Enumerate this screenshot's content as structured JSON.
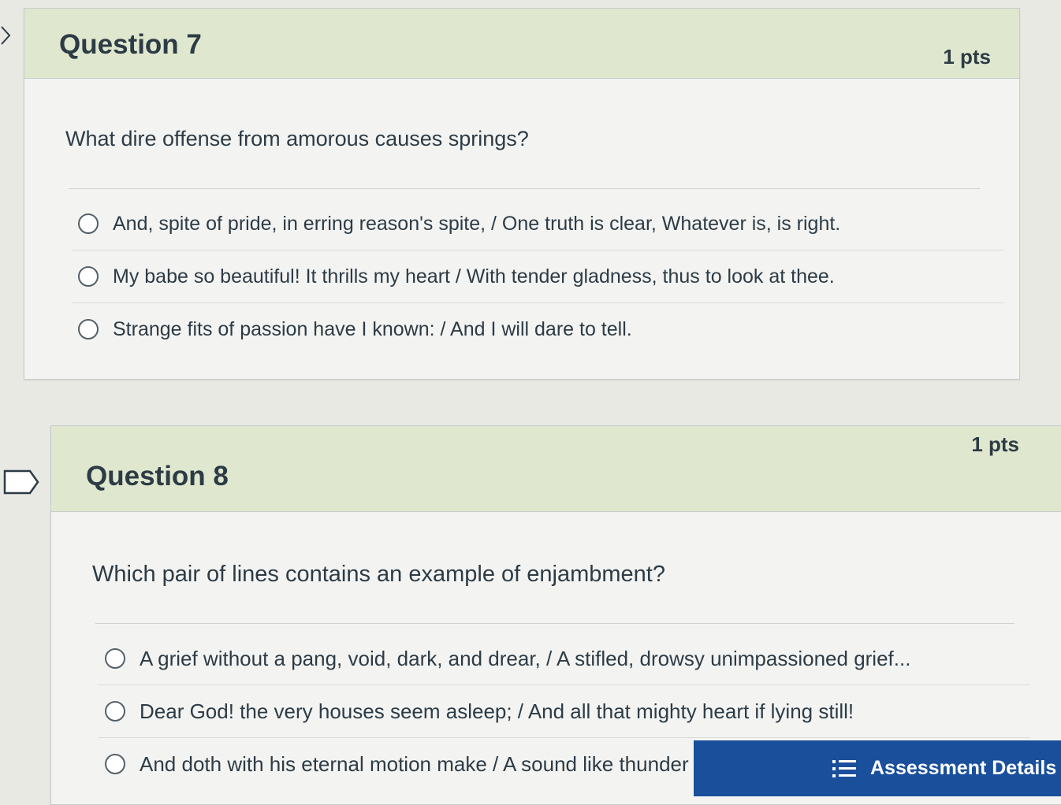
{
  "questions": [
    {
      "title": "Question 7",
      "points": "1 pts",
      "text": "What dire offense from amorous causes springs?",
      "answers": [
        "And, spite of pride, in erring reason's spite, / One truth is clear, Whatever is, is right.",
        "My babe so beautiful!  It thrills my heart / With tender gladness, thus to look at thee.",
        "Strange fits of passion have I known: / And I will dare to tell."
      ]
    },
    {
      "title": "Question 8",
      "points": "1 pts",
      "text": "Which pair of lines contains an example of enjambment?",
      "answers": [
        "A grief without a pang, void, dark, and drear, / A stifled, drowsy unimpassioned grief...",
        "Dear God!  the very houses seem asleep; / And all that mighty heart if lying still!",
        "And doth with his eternal motion make / A sound like thunder - everlastingly."
      ]
    }
  ],
  "footer": {
    "assessment_details": "Assessment Details"
  },
  "icons": {
    "question_7_flag": "chevron-right-icon",
    "question_8_flag": "flag-outline-icon",
    "assessment": "list-icon"
  }
}
